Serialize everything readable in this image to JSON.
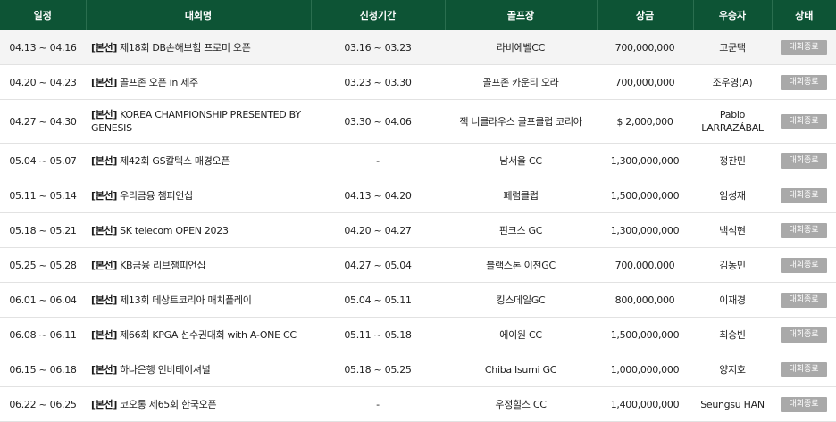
{
  "headers": {
    "date": "일정",
    "name": "대회명",
    "apply": "신청기간",
    "course": "골프장",
    "prize": "상금",
    "winner": "우승자",
    "status": "상태"
  },
  "rows": [
    {
      "date": "04.13 ~ 04.16",
      "tag": "[본선]",
      "name": "제18회 DB손해보험 프로미 오픈",
      "apply": "03.16 ~ 03.23",
      "course": "라비에벨CC",
      "prize": "700,000,000",
      "winner": "고군택",
      "status": "대회종료"
    },
    {
      "date": "04.20 ~ 04.23",
      "tag": "[본선]",
      "name": "골프존 오픈 in 제주",
      "apply": "03.23 ~ 03.30",
      "course": "골프존 카운티 오라",
      "prize": "700,000,000",
      "winner": "조우영(A)",
      "status": "대회종료"
    },
    {
      "date": "04.27 ~ 04.30",
      "tag": "[본선]",
      "name": "KOREA CHAMPIONSHIP PRESENTED BY GENESIS",
      "apply": "03.30 ~ 04.06",
      "course": "잭 니클라우스 골프클럽 코리아",
      "prize": "$ 2,000,000",
      "winner": "Pablo LARRAZÁBAL",
      "status": "대회종료"
    },
    {
      "date": "05.04 ~ 05.07",
      "tag": "[본선]",
      "name": "제42회 GS칼텍스 매경오픈",
      "apply": "-",
      "course": "남서울 CC",
      "prize": "1,300,000,000",
      "winner": "정찬민",
      "status": "대회종료"
    },
    {
      "date": "05.11 ~ 05.14",
      "tag": "[본선]",
      "name": "우리금융 챔피언십",
      "apply": "04.13 ~ 04.20",
      "course": "페럼클럽",
      "prize": "1,500,000,000",
      "winner": "임성재",
      "status": "대회종료"
    },
    {
      "date": "05.18 ~ 05.21",
      "tag": "[본선]",
      "name": "SK telecom OPEN 2023",
      "apply": "04.20 ~ 04.27",
      "course": "핀크스 GC",
      "prize": "1,300,000,000",
      "winner": "백석현",
      "status": "대회종료"
    },
    {
      "date": "05.25 ~ 05.28",
      "tag": "[본선]",
      "name": "KB금융 리브챔피언십",
      "apply": "04.27 ~ 05.04",
      "course": "블랙스톤 이천GC",
      "prize": "700,000,000",
      "winner": "김동민",
      "status": "대회종료"
    },
    {
      "date": "06.01 ~ 06.04",
      "tag": "[본선]",
      "name": "제13회 데상트코리아 매치플레이",
      "apply": "05.04 ~ 05.11",
      "course": "킹스데일GC",
      "prize": "800,000,000",
      "winner": "이재경",
      "status": "대회종료"
    },
    {
      "date": "06.08 ~ 06.11",
      "tag": "[본선]",
      "name": "제66회 KPGA 선수권대회 with A-ONE CC",
      "apply": "05.11 ~ 05.18",
      "course": "에이원 CC",
      "prize": "1,500,000,000",
      "winner": "최승빈",
      "status": "대회종료"
    },
    {
      "date": "06.15 ~ 06.18",
      "tag": "[본선]",
      "name": "하나은행 인비테이셔널",
      "apply": "05.18 ~ 05.25",
      "course": "Chiba Isumi GC",
      "prize": "1,000,000,000",
      "winner": "양지호",
      "status": "대회종료"
    },
    {
      "date": "06.22 ~ 06.25",
      "tag": "[본선]",
      "name": "코오롱 제65회 한국오픈",
      "apply": "-",
      "course": "우정힐스 CC",
      "prize": "1,400,000,000",
      "winner": "Seungsu HAN",
      "status": "대회종료"
    }
  ],
  "colors": {
    "header_bg": "#0d5435",
    "status_bg": "#a9a9a9",
    "first_row_bg": "#f4f4f4"
  }
}
